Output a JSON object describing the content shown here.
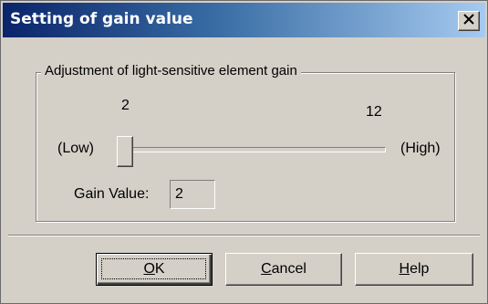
{
  "dialog": {
    "title": "Setting of gain value",
    "close_glyph": "✕"
  },
  "group": {
    "legend": "Adjustment of light-sensitive element gain",
    "slider": {
      "min_value_label": "2",
      "max_value_label": "12",
      "low_label": "(Low)",
      "high_label": "(High)",
      "min": 2,
      "max": 12,
      "value": 2
    },
    "gain": {
      "label": "Gain Value:",
      "value": "2"
    }
  },
  "buttons": {
    "ok": {
      "mnemonic": "O",
      "rest": "K"
    },
    "cancel": {
      "mnemonic": "C",
      "rest": "ancel"
    },
    "help": {
      "mnemonic": "H",
      "rest": "elp"
    }
  },
  "colors": {
    "dialog_face": "#d4d0c8",
    "title_gradient_start": "#0a246a",
    "title_gradient_end": "#a6caf0",
    "title_text": "#ffffff"
  },
  "icons": {
    "close": "close-icon"
  }
}
